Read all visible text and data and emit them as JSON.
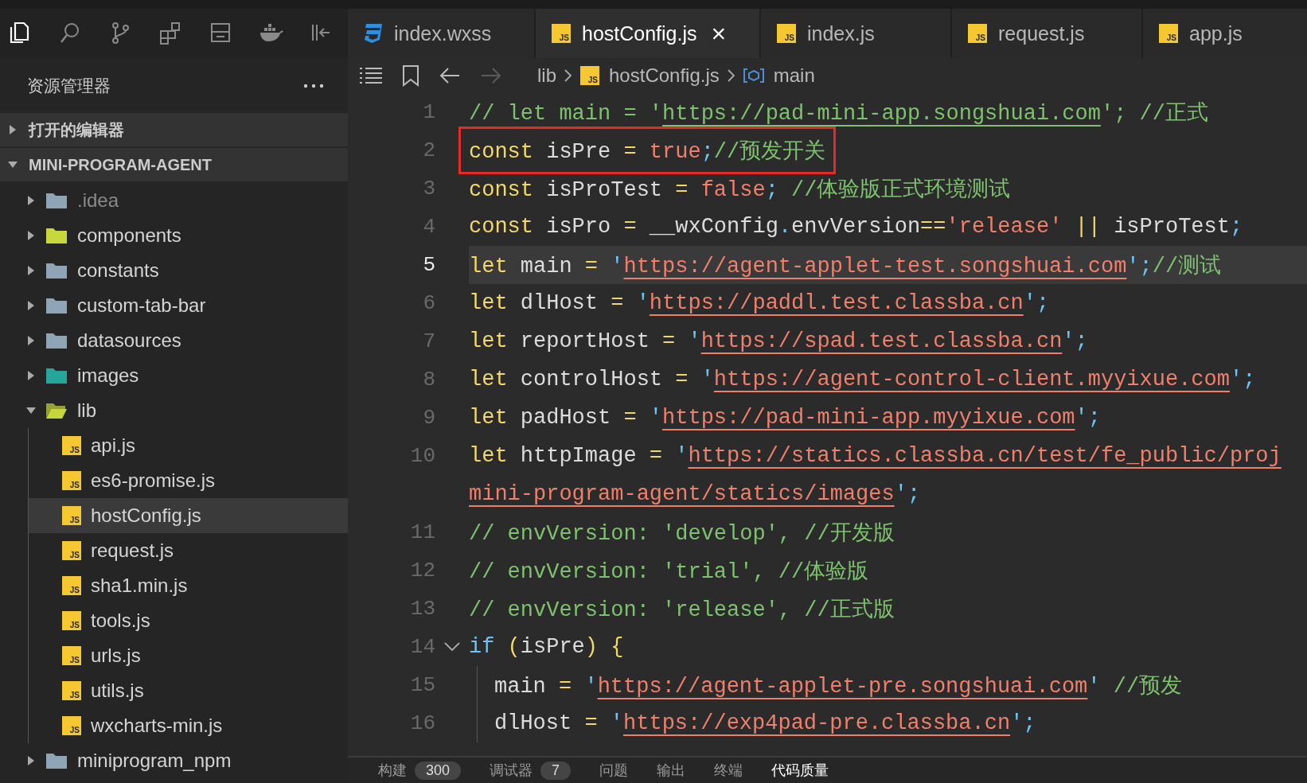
{
  "activity_bar": [
    {
      "kind": "files",
      "selected": true
    },
    {
      "kind": "search",
      "selected": false
    },
    {
      "kind": "branch",
      "selected": false
    },
    {
      "kind": "extensions",
      "selected": false
    },
    {
      "kind": "storage",
      "selected": false
    },
    {
      "kind": "whale",
      "selected": false
    },
    {
      "kind": "collapse",
      "selected": false
    }
  ],
  "explorer": {
    "title": "资源管理器",
    "sections": [
      {
        "label": "打开的编辑器",
        "expanded": false
      },
      {
        "label": "MINI-PROGRAM-AGENT",
        "expanded": true,
        "children": [
          {
            "label": ".idea",
            "kind": "folder",
            "color": "#8fa5b5",
            "expanded": false,
            "dimmed": true,
            "selected": false
          },
          {
            "label": "components",
            "kind": "folder",
            "color": "#c6d83a",
            "expanded": false,
            "dimmed": false,
            "selected": false
          },
          {
            "label": "constants",
            "kind": "folder",
            "color": "#8fa5b5",
            "expanded": false,
            "dimmed": false,
            "selected": false
          },
          {
            "label": "custom-tab-bar",
            "kind": "folder",
            "color": "#8fa5b5",
            "expanded": false,
            "dimmed": false,
            "selected": false
          },
          {
            "label": "datasources",
            "kind": "folder",
            "color": "#8fa5b5",
            "expanded": false,
            "dimmed": false,
            "selected": false
          },
          {
            "label": "images",
            "kind": "folder",
            "color": "#26a69a",
            "expanded": false,
            "dimmed": false,
            "selected": false
          },
          {
            "label": "lib",
            "kind": "folder",
            "color": "#c6d83a",
            "expanded": true,
            "dimmed": false,
            "selected": false,
            "children": [
              {
                "label": "api.js",
                "kind": "file",
                "badge": "JS",
                "dimmed": false,
                "selected": false
              },
              {
                "label": "es6-promise.js",
                "kind": "file",
                "badge": "JS",
                "dimmed": false,
                "selected": false
              },
              {
                "label": "hostConfig.js",
                "kind": "file",
                "badge": "JS",
                "dimmed": false,
                "selected": true
              },
              {
                "label": "request.js",
                "kind": "file",
                "badge": "JS",
                "dimmed": false,
                "selected": false
              },
              {
                "label": "sha1.min.js",
                "kind": "file",
                "badge": "JS",
                "dimmed": false,
                "selected": false
              },
              {
                "label": "tools.js",
                "kind": "file",
                "badge": "JS",
                "dimmed": false,
                "selected": false
              },
              {
                "label": "urls.js",
                "kind": "file",
                "badge": "JS",
                "dimmed": false,
                "selected": false
              },
              {
                "label": "utils.js",
                "kind": "file",
                "badge": "JS",
                "dimmed": false,
                "selected": false
              },
              {
                "label": "wxcharts-min.js",
                "kind": "file",
                "badge": "JS",
                "dimmed": false,
                "selected": false
              }
            ]
          },
          {
            "label": "miniprogram_npm",
            "kind": "folder",
            "color": "#8fa5b5",
            "expanded": false,
            "dimmed": false,
            "selected": false
          }
        ]
      }
    ]
  },
  "tabs": [
    {
      "label": "index.wxss",
      "kind": "css",
      "selected": false
    },
    {
      "label": "hostConfig.js",
      "kind": "js",
      "badge": "JS",
      "selected": true,
      "close": "×"
    },
    {
      "label": "index.js",
      "kind": "js",
      "badge": "JS",
      "selected": false
    },
    {
      "label": "request.js",
      "kind": "js",
      "badge": "JS",
      "selected": false
    },
    {
      "label": "app.js",
      "kind": "js",
      "badge": "JS",
      "selected": false
    }
  ],
  "breadcrumb": {
    "nav": [
      {
        "kind": "back",
        "disabled": false
      },
      {
        "kind": "forward",
        "disabled": true
      }
    ],
    "path": [
      {
        "label": "lib",
        "kind": "folder"
      },
      {
        "label": "hostConfig.js",
        "kind": "file",
        "badge": "JS"
      },
      {
        "label": "main",
        "kind": "symbol"
      }
    ]
  },
  "editor": {
    "lines": [
      {
        "number": "1",
        "current": false,
        "boxed": false,
        "foldable": false,
        "tokens": [
          {
            "kind": "c",
            "text": "// let main = '"
          },
          {
            "kind": "cu",
            "text": "https://pad-mini-app.songshuai.com"
          },
          {
            "kind": "c",
            "text": "'; //正式"
          }
        ]
      },
      {
        "number": "2",
        "current": false,
        "boxed": true,
        "foldable": false,
        "tokens": [
          {
            "kind": "k",
            "text": "const"
          },
          {
            "kind": "i",
            "text": " isPre "
          },
          {
            "kind": "o",
            "text": "= "
          },
          {
            "kind": "b",
            "text": "true"
          },
          {
            "kind": "p",
            "text": ";"
          },
          {
            "kind": "c",
            "text": "//预发开关"
          }
        ]
      },
      {
        "number": "3",
        "current": false,
        "boxed": false,
        "foldable": false,
        "tokens": [
          {
            "kind": "k",
            "text": "const"
          },
          {
            "kind": "i",
            "text": " isProTest "
          },
          {
            "kind": "o",
            "text": "= "
          },
          {
            "kind": "b",
            "text": "false"
          },
          {
            "kind": "p",
            "text": ";"
          },
          {
            "kind": "c",
            "text": " //体验版正式环境测试"
          }
        ]
      },
      {
        "number": "4",
        "current": false,
        "boxed": false,
        "foldable": false,
        "tokens": [
          {
            "kind": "k",
            "text": "const"
          },
          {
            "kind": "i",
            "text": " isPro "
          },
          {
            "kind": "o",
            "text": "="
          },
          {
            "kind": "i",
            "text": " __wxConfig"
          },
          {
            "kind": "p",
            "text": "."
          },
          {
            "kind": "i",
            "text": "envVersion"
          },
          {
            "kind": "o",
            "text": "=="
          },
          {
            "kind": "b",
            "text": "'release'"
          },
          {
            "kind": "o",
            "text": " ||"
          },
          {
            "kind": "i",
            "text": " isProTest"
          },
          {
            "kind": "p",
            "text": ";"
          }
        ]
      },
      {
        "number": "5",
        "current": true,
        "boxed": false,
        "foldable": false,
        "tokens": [
          {
            "kind": "k",
            "text": "let"
          },
          {
            "kind": "i",
            "text": " main "
          },
          {
            "kind": "o",
            "text": "= "
          },
          {
            "kind": "p",
            "text": "'"
          },
          {
            "kind": "u",
            "text": "https://agent-applet-test.songshuai.com"
          },
          {
            "kind": "p",
            "text": "';"
          },
          {
            "kind": "c",
            "text": "//测试"
          }
        ]
      },
      {
        "number": "6",
        "current": false,
        "boxed": false,
        "foldable": false,
        "tokens": [
          {
            "kind": "k",
            "text": "let"
          },
          {
            "kind": "i",
            "text": " dlHost "
          },
          {
            "kind": "o",
            "text": "= "
          },
          {
            "kind": "p",
            "text": "'"
          },
          {
            "kind": "u",
            "text": "https://paddl.test.classba.cn"
          },
          {
            "kind": "p",
            "text": "';"
          }
        ]
      },
      {
        "number": "7",
        "current": false,
        "boxed": false,
        "foldable": false,
        "tokens": [
          {
            "kind": "k",
            "text": "let"
          },
          {
            "kind": "i",
            "text": " reportHost "
          },
          {
            "kind": "o",
            "text": "= "
          },
          {
            "kind": "p",
            "text": "'"
          },
          {
            "kind": "u",
            "text": "https://spad.test.classba.cn"
          },
          {
            "kind": "p",
            "text": "';"
          }
        ]
      },
      {
        "number": "8",
        "current": false,
        "boxed": false,
        "foldable": false,
        "tokens": [
          {
            "kind": "k",
            "text": "let"
          },
          {
            "kind": "i",
            "text": " controlHost "
          },
          {
            "kind": "o",
            "text": "= "
          },
          {
            "kind": "p",
            "text": "'"
          },
          {
            "kind": "u",
            "text": "https://agent-control-client.myyixue.com"
          },
          {
            "kind": "p",
            "text": "';"
          }
        ]
      },
      {
        "number": "9",
        "current": false,
        "boxed": false,
        "foldable": false,
        "tokens": [
          {
            "kind": "k",
            "text": "let"
          },
          {
            "kind": "i",
            "text": " padHost "
          },
          {
            "kind": "o",
            "text": "= "
          },
          {
            "kind": "p",
            "text": "'"
          },
          {
            "kind": "u",
            "text": "https://pad-mini-app.myyixue.com"
          },
          {
            "kind": "p",
            "text": "';"
          }
        ]
      },
      {
        "number": "10",
        "current": false,
        "boxed": false,
        "foldable": false,
        "tokens": [
          {
            "kind": "k",
            "text": "let"
          },
          {
            "kind": "i",
            "text": " httpImage "
          },
          {
            "kind": "o",
            "text": "= "
          },
          {
            "kind": "p",
            "text": "'"
          },
          {
            "kind": "u",
            "text": "https://statics.classba.cn/test/fe_public/proj"
          }
        ],
        "wrap": [
          {
            "kind": "u",
            "text": "mini-program-agent/statics/images"
          },
          {
            "kind": "p",
            "text": "';"
          }
        ]
      },
      {
        "number": "11",
        "current": false,
        "boxed": false,
        "foldable": false,
        "tokens": [
          {
            "kind": "c",
            "text": "// envVersion: 'develop', //开发版"
          }
        ]
      },
      {
        "number": "12",
        "current": false,
        "boxed": false,
        "foldable": false,
        "tokens": [
          {
            "kind": "c",
            "text": "// envVersion: 'trial', //体验版"
          }
        ]
      },
      {
        "number": "13",
        "current": false,
        "boxed": false,
        "foldable": false,
        "tokens": [
          {
            "kind": "c",
            "text": "// envVersion: 'release', //正式版"
          }
        ]
      },
      {
        "number": "14",
        "current": false,
        "boxed": false,
        "foldable": true,
        "tokens": [
          {
            "kind": "f",
            "text": "if "
          },
          {
            "kind": "y",
            "text": "("
          },
          {
            "kind": "i",
            "text": "isPre"
          },
          {
            "kind": "y",
            "text": ") {"
          }
        ],
        "children": [
          {
            "number": "15",
            "current": false,
            "boxed": false,
            "foldable": false,
            "tokens": [
              {
                "kind": "i",
                "text": "main "
              },
              {
                "kind": "o",
                "text": "= "
              },
              {
                "kind": "p",
                "text": "'"
              },
              {
                "kind": "u",
                "text": "https://agent-applet-pre.songshuai.com"
              },
              {
                "kind": "p",
                "text": "'"
              },
              {
                "kind": "c",
                "text": " //预发"
              }
            ]
          },
          {
            "number": "16",
            "current": false,
            "boxed": false,
            "foldable": false,
            "tokens": [
              {
                "kind": "i",
                "text": "dlHost "
              },
              {
                "kind": "o",
                "text": "= "
              },
              {
                "kind": "p",
                "text": "'"
              },
              {
                "kind": "u",
                "text": "https://exp4pad-pre.classba.cn"
              },
              {
                "kind": "p",
                "text": "';"
              }
            ]
          }
        ]
      }
    ]
  },
  "panel": {
    "tabs": [
      {
        "label": "构建",
        "count": "300",
        "selected": false
      },
      {
        "label": "调试器",
        "count": "7",
        "selected": false
      },
      {
        "label": "问题",
        "selected": false
      },
      {
        "label": "输出",
        "selected": false
      },
      {
        "label": "终端",
        "selected": false
      },
      {
        "label": "代码质量",
        "selected": true
      }
    ]
  }
}
